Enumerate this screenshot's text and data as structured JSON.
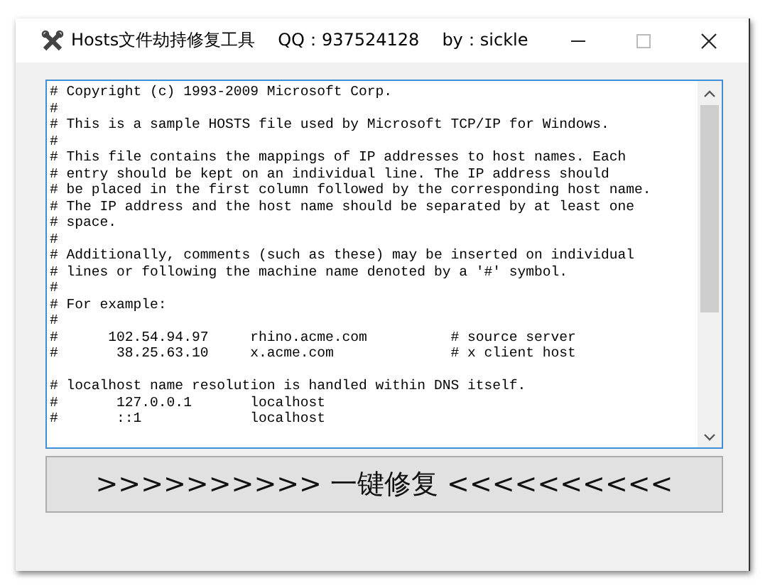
{
  "window": {
    "title": "Hosts文件劫持修复工具",
    "qq": "QQ：937524128",
    "author": "by：sickle"
  },
  "hosts_text": "# Copyright (c) 1993-2009 Microsoft Corp.\n#\n# This is a sample HOSTS file used by Microsoft TCP/IP for Windows.\n#\n# This file contains the mappings of IP addresses to host names. Each\n# entry should be kept on an individual line. The IP address should\n# be placed in the first column followed by the corresponding host name.\n# The IP address and the host name should be separated by at least one\n# space.\n#\n# Additionally, comments (such as these) may be inserted on individual\n# lines or following the machine name denoted by a '#' symbol.\n#\n# For example:\n#\n#      102.54.94.97     rhino.acme.com          # source server\n#       38.25.63.10     x.acme.com              # x client host\n\n# localhost name resolution is handled within DNS itself.\n#       127.0.0.1       localhost\n#       ::1             localhost",
  "fix_button": {
    "label": ">>>>>>>>>> 一键修复 <<<<<<<<<<"
  }
}
